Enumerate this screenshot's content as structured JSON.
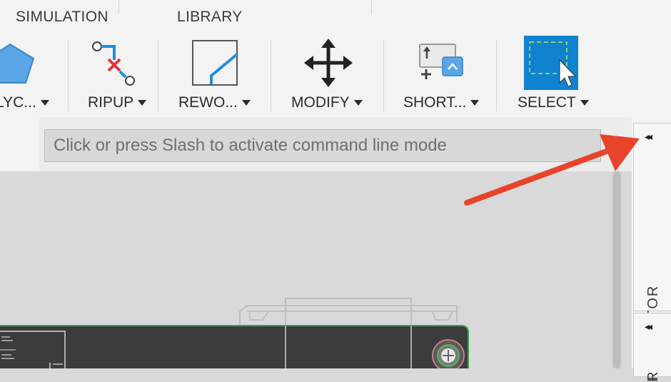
{
  "tabs": [
    {
      "label": "SIMULATION"
    },
    {
      "label": "LIBRARY"
    }
  ],
  "toolbar": {
    "tools": [
      {
        "label": "LYC..."
      },
      {
        "label": "RIPUP"
      },
      {
        "label": "REWO..."
      },
      {
        "label": "MODIFY"
      },
      {
        "label": "SHORT..."
      },
      {
        "label": "SELECT"
      }
    ]
  },
  "command_line": {
    "placeholder": "Click or press Slash to activate command line mode"
  },
  "right_panel": {
    "inspector_label": "INSPECTOR",
    "second_label": "R",
    "collapse_glyph": "◂◂"
  },
  "colors": {
    "accent_blue": "#0f82d0",
    "annotation_arrow": "#e8432b",
    "ripup_red": "#e33535",
    "wire_blue": "#1d8de0",
    "board_dark": "#3c3c3c",
    "board_green": "#3fa14c"
  },
  "annotation": {
    "type": "arrow",
    "points_to": "inspector-collapse-button"
  }
}
